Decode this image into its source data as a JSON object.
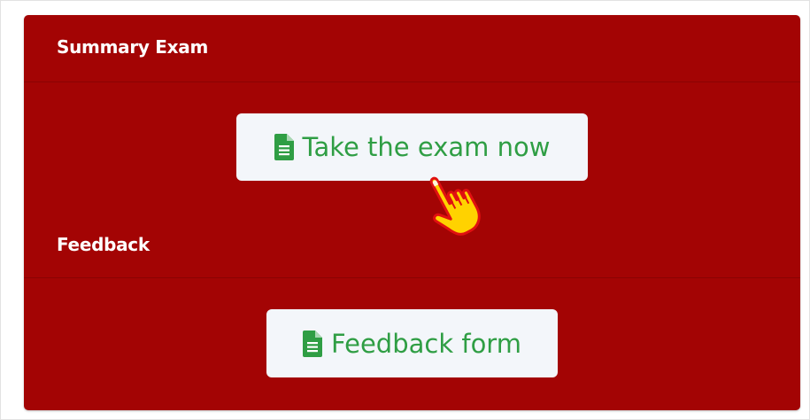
{
  "sections": {
    "exam": {
      "title": "Summary Exam",
      "button_label": "Take the exam now",
      "button_icon": "document-icon"
    },
    "feedback": {
      "title": "Feedback",
      "button_label": "Feedback form",
      "button_icon": "document-icon"
    }
  },
  "colors": {
    "card_background": "#a30404",
    "button_background": "#f3f6fa",
    "button_text": "#2f9e44",
    "icon_green": "#2f9e44",
    "cursor_yellow": "#ffd200",
    "cursor_red": "#e01010"
  },
  "cursor": {
    "icon": "pointing-hand-cursor-icon"
  }
}
